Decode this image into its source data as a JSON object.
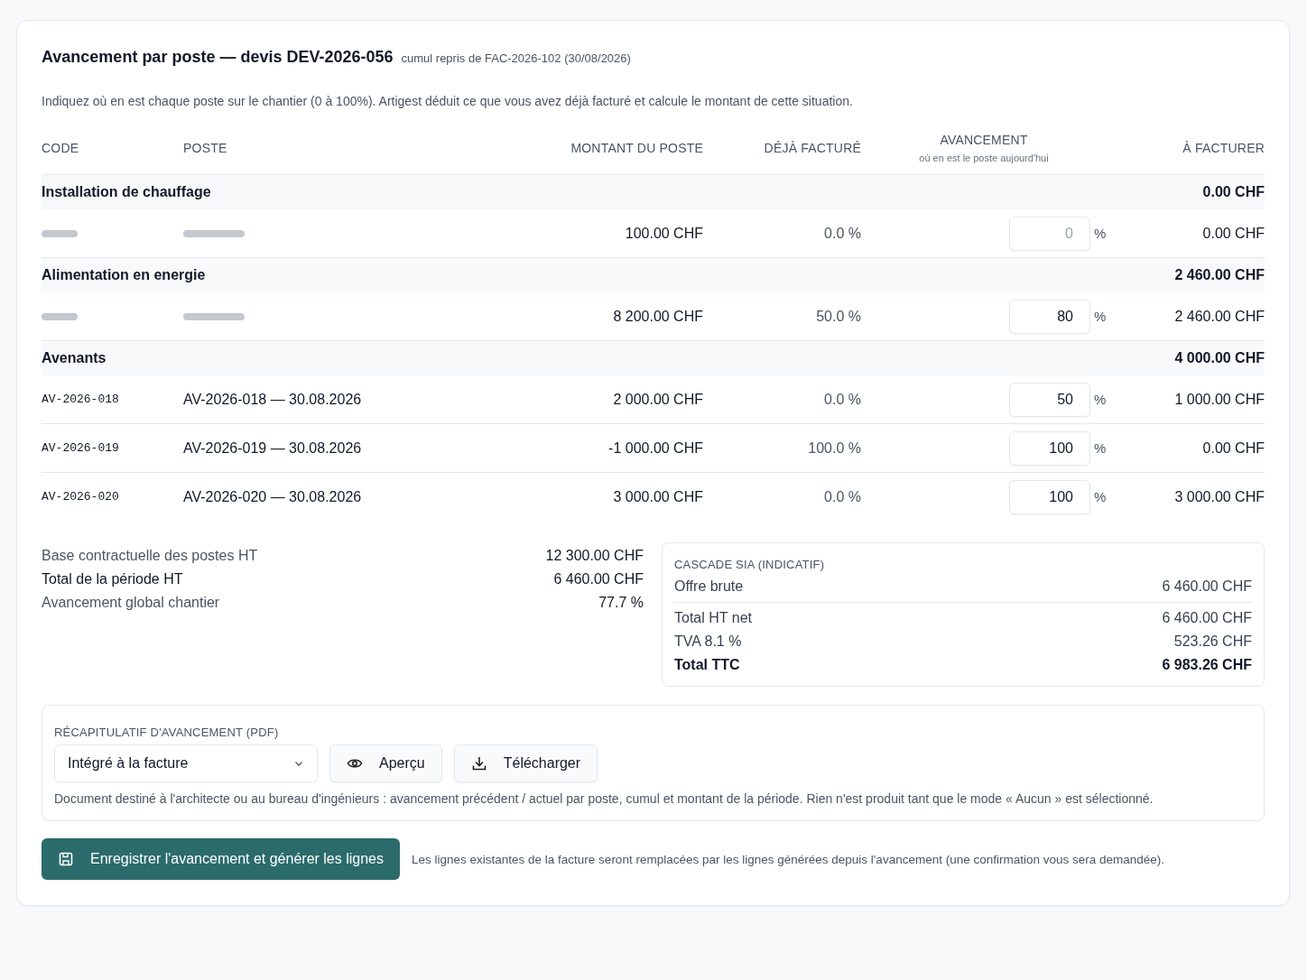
{
  "header": {
    "title": "Avancement par poste — devis DEV-2026-056",
    "subtitle": "cumul repris de FAC-2026-102 (30/08/2026)"
  },
  "intro": "Indiquez où en est chaque poste sur le chantier (0 à 100%). Artigest déduit ce que vous avez déjà facturé et calcule le montant de cette situation.",
  "table": {
    "columns": [
      {
        "label": "CODE"
      },
      {
        "label": "POSTE"
      },
      {
        "label": "MONTANT DU POSTE"
      },
      {
        "label": "DÉJÀ FACTURÉ"
      },
      {
        "label": "AVANCEMENT",
        "hint": "où en est le poste aujourd'hui"
      },
      {
        "label": "À FACTURER"
      }
    ],
    "groups": [
      {
        "title": "Installation de chauffage",
        "total": "0.00 CHF",
        "rows": [
          {
            "kind": "redacted",
            "montant": "100.00 CHF",
            "deja": "0.0 %",
            "avancement": {
              "placeholder": "0"
            },
            "unit": "%",
            "a_facturer": "0.00 CHF"
          }
        ]
      },
      {
        "title": "Alimentation en energie",
        "total": "2 460.00 CHF",
        "rows": [
          {
            "kind": "redacted",
            "montant": "8 200.00 CHF",
            "deja": "50.0 %",
            "avancement": {
              "value": "80"
            },
            "unit": "%",
            "a_facturer": "2 460.00 CHF"
          }
        ]
      },
      {
        "title": "Avenants",
        "total": "4 000.00 CHF",
        "rows": [
          {
            "kind": "plain",
            "code": "AV-2026-018",
            "poste": "AV-2026-018 — 30.08.2026",
            "montant": "2 000.00 CHF",
            "deja": "0.0 %",
            "avancement": {
              "value": "50"
            },
            "unit": "%",
            "a_facturer": "1 000.00 CHF"
          },
          {
            "kind": "plain",
            "code": "AV-2026-019",
            "poste": "AV-2026-019 — 30.08.2026",
            "montant": "-1 000.00 CHF",
            "deja": "100.0 %",
            "avancement": {
              "value": "100"
            },
            "unit": "%",
            "a_facturer": "0.00 CHF"
          },
          {
            "kind": "plain",
            "code": "AV-2026-020",
            "poste": "AV-2026-020 — 30.08.2026",
            "montant": "3 000.00 CHF",
            "deja": "0.0 %",
            "avancement": {
              "value": "100"
            },
            "unit": "%",
            "a_facturer": "3 000.00 CHF"
          }
        ]
      }
    ]
  },
  "summary": [
    {
      "label": "Base contractuelle des postes HT",
      "value": "12 300.00 CHF",
      "kind": "muted"
    },
    {
      "label": "Total de la période HT",
      "value": "6 460.00 CHF",
      "kind": "strong"
    },
    {
      "label": "Avancement global chantier",
      "value": "77.7 %",
      "kind": "muted"
    }
  ],
  "cascade": {
    "title": "CASCADE SIA (INDICATIF)",
    "lines": [
      {
        "label": "Offre brute",
        "value": "6 460.00 CHF",
        "kind": "first"
      },
      {
        "label": "Total HT net",
        "value": "6 460.00 CHF",
        "kind": "normal"
      },
      {
        "label": "TVA 8.1 %",
        "value": "523.26 CHF",
        "kind": "normal"
      },
      {
        "label": "Total TTC",
        "value": "6 983.26 CHF",
        "kind": "total"
      }
    ]
  },
  "pdf": {
    "title": "RÉCAPITULATIF D'AVANCEMENT (PDF)",
    "mode": "Intégré à la facture",
    "buttons": [
      {
        "label": "Aperçu",
        "kind": "preview"
      },
      {
        "label": "Télécharger",
        "kind": "download"
      }
    ],
    "note": "Document destiné à l'architecte ou au bureau d'ingénieurs : avancement précédent / actuel par poste, cumul et montant de la période. Rien n'est produit tant que le mode « Aucun » est sélectionné."
  },
  "footer": {
    "button": "Enregistrer l'avancement et générer les lignes",
    "note": "Les lignes existantes de la facture seront remplacées par les lignes générées depuis l'avancement (une confirmation vous sera demandée)."
  }
}
